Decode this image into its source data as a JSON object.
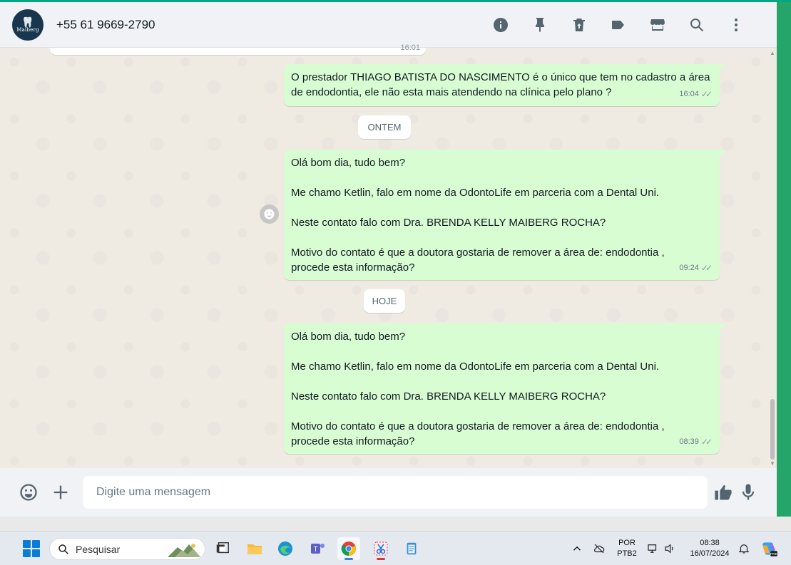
{
  "header": {
    "avatar_line1": "🦷",
    "avatar_line2": "Maiberg",
    "contact_name": "+55 61 9669-2790",
    "icons": [
      "info-icon",
      "pin-icon",
      "delete-icon",
      "label-icon",
      "catalog-icon",
      "search-icon",
      "menu-icon"
    ]
  },
  "chat": {
    "prev_time": "16:01",
    "messages": [
      {
        "lines": [
          "O prestador THIAGO BATISTA DO NASCIMENTO é o único que tem no cadastro a área de endodontia, ele não esta mais atendendo na clínica pelo plano ?"
        ],
        "time": "16:04"
      },
      {
        "date": "ONTEM",
        "lines": [
          "Olá bom dia, tudo bem?",
          "Me chamo Ketlin, falo em nome da OdontoLife em parceria com a Dental Uni.",
          "Neste contato falo com Dra. BRENDA KELLY MAIBERG ROCHA?",
          "Motivo do contato é que a doutora gostaria de remover a área de: endodontia , procede esta informação?"
        ],
        "time": "09:24"
      },
      {
        "date": "HOJE",
        "lines": [
          "Olá bom dia, tudo bem?",
          "Me chamo Ketlin, falo em nome da OdontoLife em parceria com a Dental Uni.",
          "Neste contato falo com Dra. BRENDA KELLY MAIBERG ROCHA?",
          "Motivo do contato é que a doutora gostaria de remover a área de: endodontia , procede esta informação?"
        ],
        "time": "08:39"
      }
    ]
  },
  "composer": {
    "placeholder": "Digite uma mensagem"
  },
  "taskbar": {
    "search_label": "Pesquisar",
    "language_line1": "POR",
    "language_line2": "PTB2",
    "time": "08:38",
    "date": "16/07/2024"
  },
  "colors": {
    "outgoing_bubble": "#d9fdd3",
    "accent": "#00a884",
    "background": "#efeae2"
  }
}
